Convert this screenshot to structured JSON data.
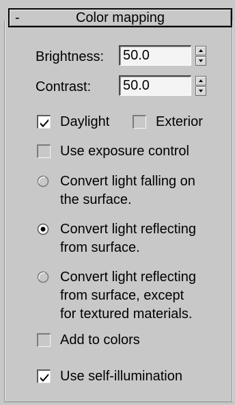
{
  "rollout": {
    "collapse_symbol": "-",
    "title": "Color mapping"
  },
  "brightness": {
    "label": "Brightness:",
    "value": "50.0"
  },
  "contrast": {
    "label": "Contrast:",
    "value": "50.0"
  },
  "checkboxes": {
    "daylight": {
      "label": "Daylight",
      "checked": true
    },
    "exterior": {
      "label": "Exterior",
      "checked": false
    },
    "use_exposure_control": {
      "label": "Use exposure control",
      "checked": false
    },
    "add_to_colors": {
      "label": "Add to colors",
      "checked": false
    },
    "use_self_illumination": {
      "label": "Use self-illumination",
      "checked": true
    }
  },
  "radios": {
    "light_falling": {
      "line1": "Convert light falling on",
      "line2": "the surface.",
      "selected": false
    },
    "light_reflecting": {
      "line1": "Convert light reflecting",
      "line2": "from surface.",
      "selected": true
    },
    "light_reflecting_except": {
      "line1": "Convert light reflecting",
      "line2": "from surface, except",
      "line3": "for textured materials.",
      "selected": false
    }
  },
  "icons": {
    "check": "check-icon",
    "spin_up": "spinner-up-arrow-icon",
    "spin_down": "spinner-down-arrow-icon"
  },
  "colors": {
    "panel_bg": "#c8c8c8",
    "field_bg": "#f4f4f4"
  }
}
